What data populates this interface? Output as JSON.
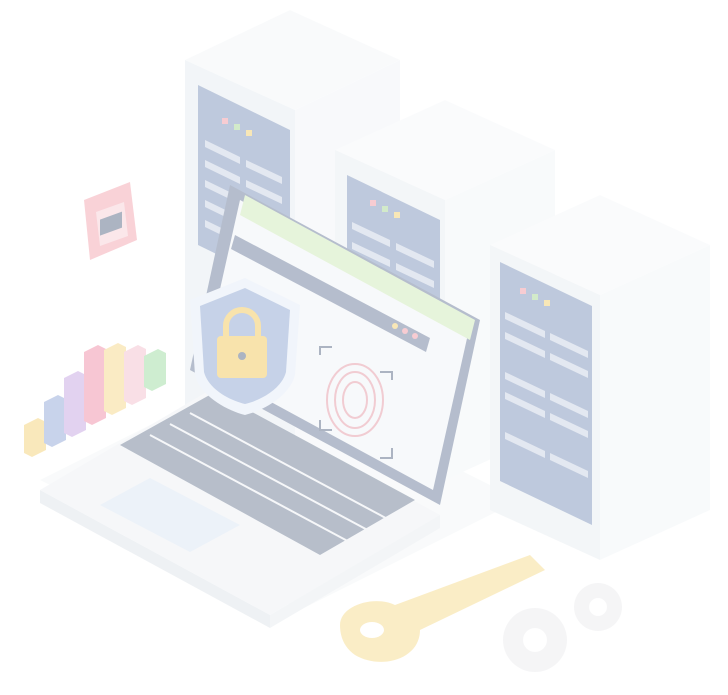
{
  "colors": {
    "server_face": "#e9eef2",
    "server_side": "#f3f6f8",
    "server_top": "#f7f9fb",
    "server_panel": "#7e93b8",
    "server_slot": "#c7d0e2",
    "laptop_body": "#f1f3f6",
    "laptop_screen_frame": "#6e7e9c",
    "window_header": "#6e7e9c",
    "window_bg": "#eef1f5",
    "green_panel": "#cfeab8",
    "shield_blue": "#8fa8d1",
    "lock_yellow": "#f3c85b",
    "key_yellow": "#f7dc8f",
    "gear_gray": "#ececef",
    "padlock_badge": "#f4a6b1",
    "fingerprint": "#e79aa5",
    "bar_colors": [
      "#f4d27a",
      "#93a8d8",
      "#c7a6e3",
      "#f08fa8",
      "#f6d98a",
      "#f4c0cf",
      "#9fdca3"
    ]
  },
  "icons": [
    "server-rack-icon",
    "laptop-icon",
    "shield-lock-icon",
    "fingerprint-icon",
    "padlock-badge-icon",
    "key-icon",
    "gear-icon",
    "bar-chart-icon"
  ]
}
